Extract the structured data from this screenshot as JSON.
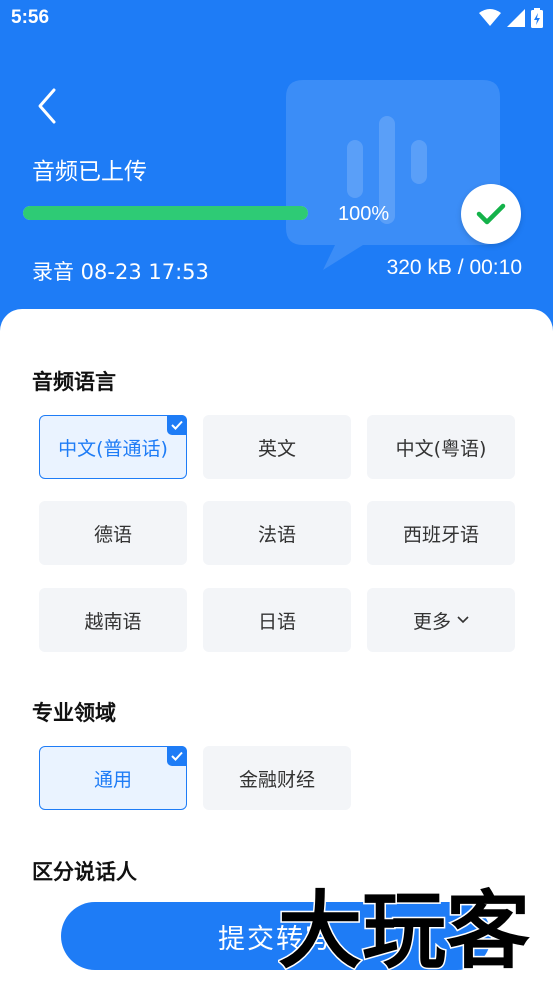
{
  "status_bar": {
    "time": "5:56"
  },
  "header": {
    "title": "音频已上传",
    "progress_percent": 100,
    "progress_label": "100%",
    "recording_name": "录音 08-23 17:53",
    "recording_meta": "320 kB /  00:10"
  },
  "audio_language": {
    "title": "音频语言",
    "options": [
      {
        "label": "中文(普通话)",
        "selected": true
      },
      {
        "label": "英文",
        "selected": false
      },
      {
        "label": "中文(粤语)",
        "selected": false
      },
      {
        "label": "德语",
        "selected": false
      },
      {
        "label": "法语",
        "selected": false
      },
      {
        "label": "西班牙语",
        "selected": false
      },
      {
        "label": "越南语",
        "selected": false
      },
      {
        "label": "日语",
        "selected": false
      },
      {
        "label": "更多",
        "selected": false
      }
    ]
  },
  "domain": {
    "title": "专业领域",
    "options": [
      {
        "label": "通用",
        "selected": true
      },
      {
        "label": "金融财经",
        "selected": false
      }
    ]
  },
  "speaker": {
    "title": "区分说话人"
  },
  "submit_label": "提交转写",
  "watermark_text": "大玩客",
  "colors": {
    "primary": "#1e7cf6",
    "progress": "#2ecb75",
    "chip_bg": "#f3f5f8"
  }
}
